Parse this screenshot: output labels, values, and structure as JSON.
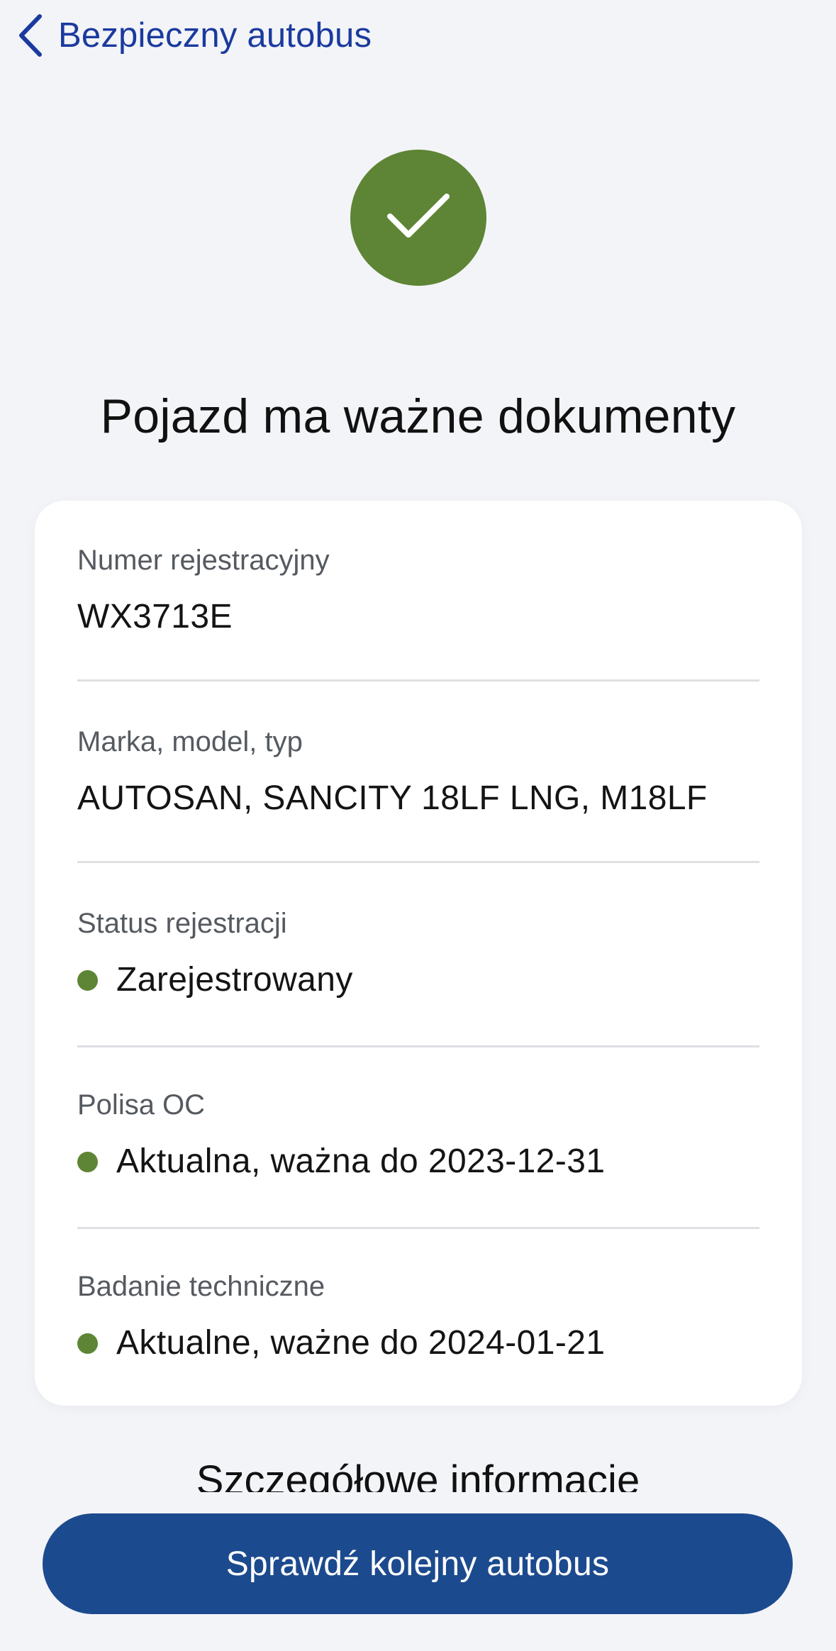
{
  "nav": {
    "back_icon": "chevron-left-icon",
    "back_label": "Bezpieczny autobus"
  },
  "status": {
    "icon": "checkmark-icon",
    "color": "#5d8535",
    "headline": "Pojazd ma ważne dokumenty"
  },
  "details": {
    "registration": {
      "label": "Numer rejestracyjny",
      "value": "WX3713E"
    },
    "make_model": {
      "label": "Marka, model, typ",
      "value": "AUTOSAN, SANCITY 18LF LNG, M18LF"
    },
    "registration_status": {
      "label": "Status rejestracji",
      "value": "Zarejestrowany",
      "indicator_color": "#5d8535"
    },
    "insurance": {
      "label": "Polisa OC",
      "value": "Aktualna, ważna do 2023-12-31",
      "indicator_color": "#5d8535"
    },
    "inspection": {
      "label": "Badanie techniczne",
      "value": "Aktualne, ważne do 2024-01-21",
      "indicator_color": "#5d8535"
    }
  },
  "more_info_link": "Szczegółowe informacje",
  "cta": {
    "label": "Sprawdź kolejny autobus",
    "color": "#1c4a8e"
  }
}
